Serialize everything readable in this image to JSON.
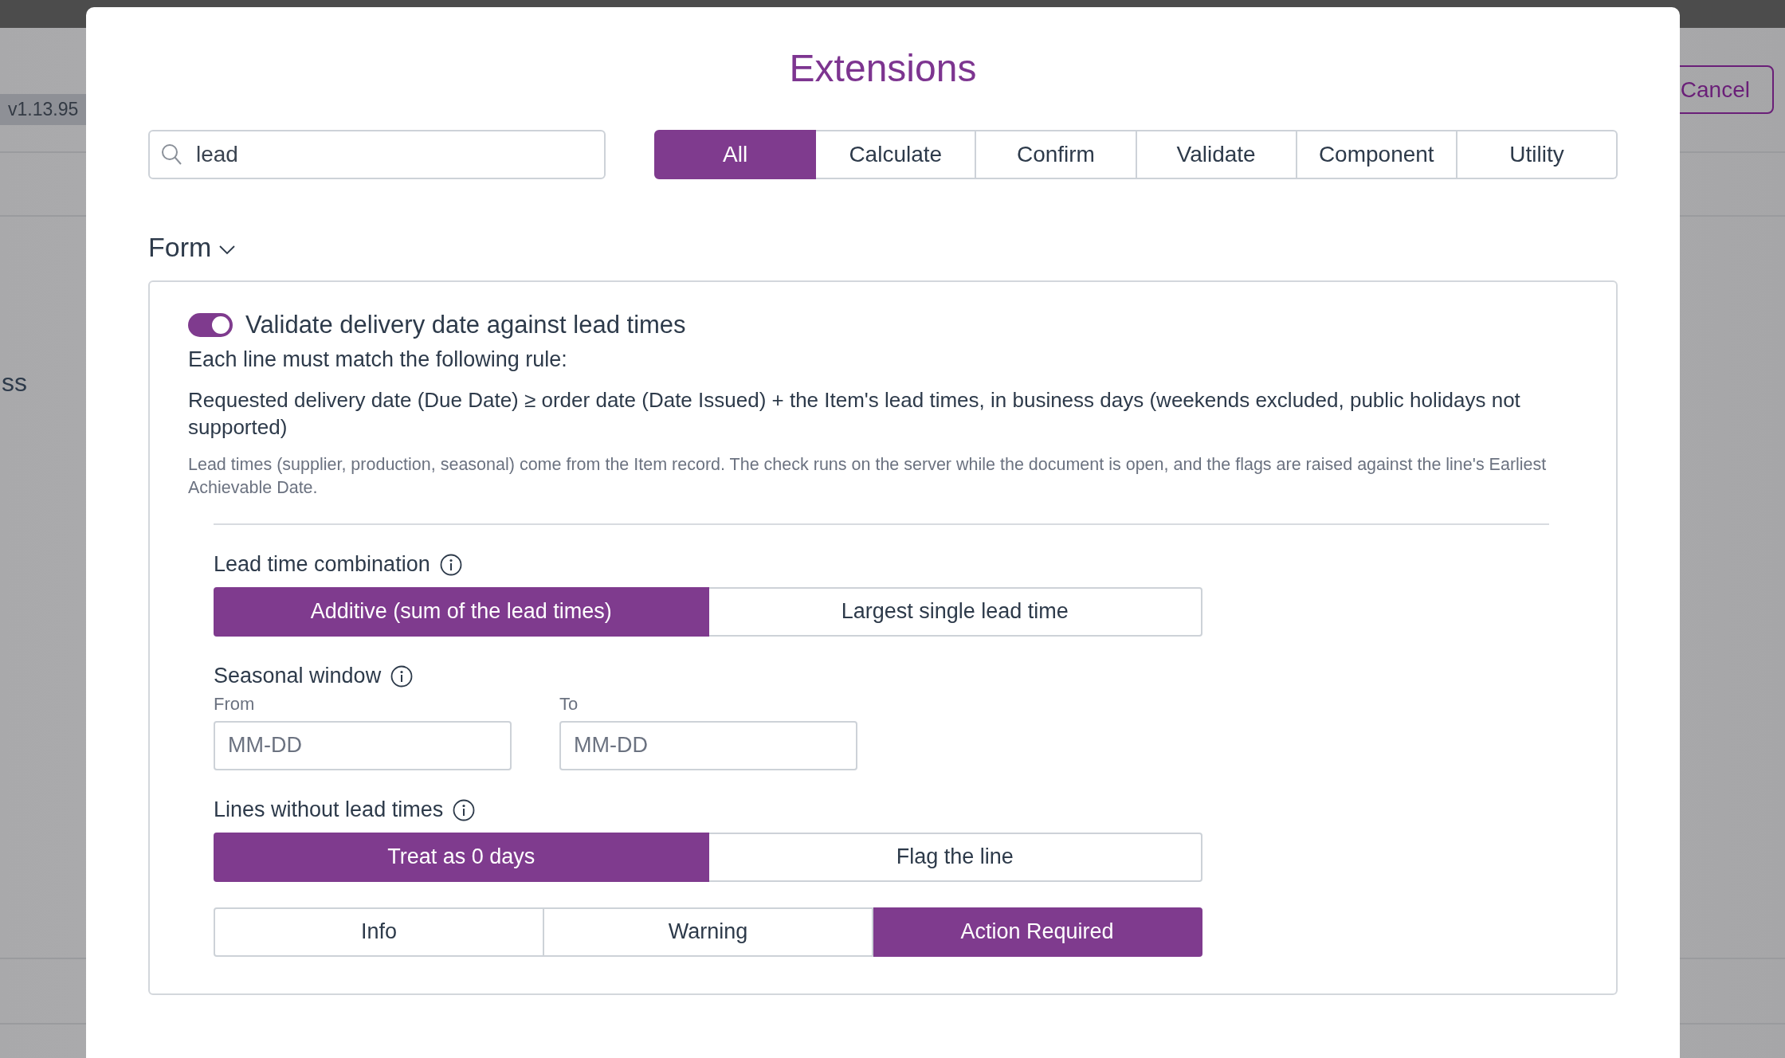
{
  "background": {
    "version_badge": "v1.13.95",
    "partial_heading": "ss",
    "cancel_button": "Cancel"
  },
  "dialog": {
    "title": "Extensions",
    "search": {
      "value": "lead"
    },
    "filter_tabs": [
      {
        "label": "All",
        "selected": true
      },
      {
        "label": "Calculate",
        "selected": false
      },
      {
        "label": "Confirm",
        "selected": false
      },
      {
        "label": "Validate",
        "selected": false
      },
      {
        "label": "Component",
        "selected": false
      },
      {
        "label": "Utility",
        "selected": false
      }
    ],
    "section": {
      "title": "Form",
      "expanded": true
    },
    "extension": {
      "enabled": true,
      "title": "Validate delivery date against lead times",
      "rule_intro": "Each line must match the following rule:",
      "rule": "Requested delivery date (Due Date) ≥ order date (Date Issued) + the Item's lead times, in business days (weekends excluded, public holidays not supported)",
      "note": "Lead times (supplier, production, seasonal) come from the Item record. The check runs on the server while the document is open, and the flags are raised against the line's Earliest Achievable Date.",
      "settings": [
        {
          "kind": "segmented",
          "label": "Lead time combination",
          "options": [
            {
              "label": "Additive (sum of the lead times)",
              "selected": true
            },
            {
              "label": "Largest single lead time",
              "selected": false
            }
          ]
        },
        {
          "kind": "date_range",
          "label": "Seasonal window",
          "fields": [
            {
              "label": "From",
              "placeholder": "MM-DD"
            },
            {
              "label": "To",
              "placeholder": "MM-DD"
            }
          ]
        },
        {
          "kind": "segmented",
          "label": "Lines without lead times",
          "options": [
            {
              "label": "Treat as 0 days",
              "selected": true
            },
            {
              "label": "Flag the line",
              "selected": false
            }
          ]
        },
        {
          "kind": "segmented",
          "options": [
            {
              "label": "Info",
              "selected": false
            },
            {
              "label": "Warning",
              "selected": false
            },
            {
              "label": "Action Required",
              "selected": true
            }
          ]
        }
      ]
    }
  }
}
